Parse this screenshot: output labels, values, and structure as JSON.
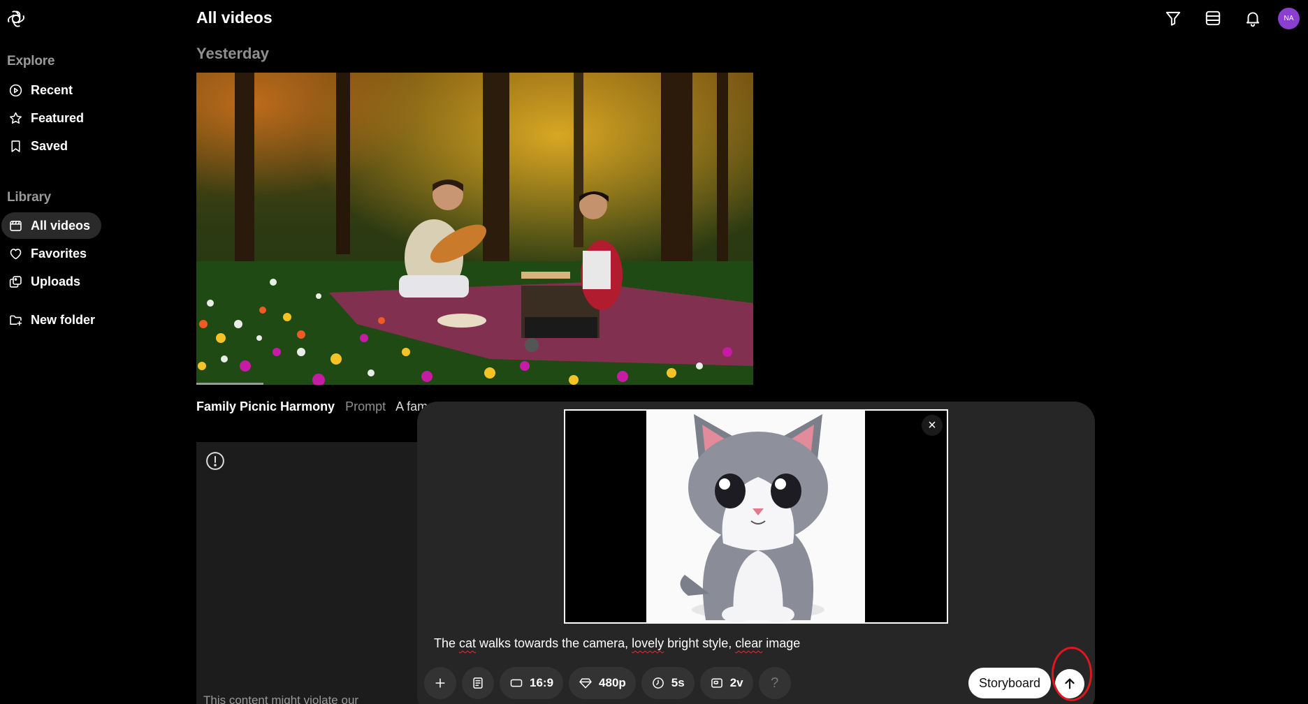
{
  "sidebar": {
    "logo_icon": "openai-logo-icon",
    "explore_heading": "Explore",
    "explore_items": [
      {
        "label": "Recent",
        "icon": "play-circle-icon"
      },
      {
        "label": "Featured",
        "icon": "star-icon"
      },
      {
        "label": "Saved",
        "icon": "bookmark-icon"
      }
    ],
    "library_heading": "Library",
    "library_items": [
      {
        "label": "All videos",
        "icon": "video-library-icon",
        "active": true
      },
      {
        "label": "Favorites",
        "icon": "heart-icon"
      },
      {
        "label": "Uploads",
        "icon": "uploads-icon"
      }
    ],
    "new_folder_label": "New folder"
  },
  "header": {
    "title": "All videos",
    "icons": [
      "filter-icon",
      "grid-view-icon",
      "bell-icon"
    ],
    "avatar_initials": "NA",
    "avatar_color": "#8a3fd1"
  },
  "feed": {
    "date_heading": "Yesterday",
    "video": {
      "title": "Family Picnic Harmony",
      "prompt_label": "Prompt",
      "prompt_text": "A family",
      "progress": 0.12
    },
    "error_card": {
      "icon": "warning-circle-icon",
      "text": "This content might violate our"
    }
  },
  "composer": {
    "image_preview": "cat-cartoon-image",
    "close_icon": "close-icon",
    "prompt_parts": [
      "The ",
      "cat",
      " walks towards the camera, ",
      "lovely",
      " bright style, ",
      "clear",
      " image"
    ],
    "tools": [
      {
        "icon": "plus-icon",
        "label": ""
      },
      {
        "icon": "storyboard-doc-icon",
        "label": ""
      },
      {
        "icon": "aspect-ratio-icon",
        "label": "16:9"
      },
      {
        "icon": "resolution-icon",
        "label": "480p"
      },
      {
        "icon": "duration-clock-icon",
        "label": "5s"
      },
      {
        "icon": "variations-icon",
        "label": "2v"
      },
      {
        "icon": "help-icon",
        "label": "?"
      }
    ],
    "storyboard_label": "Storyboard",
    "submit_icon": "arrow-up-icon"
  }
}
